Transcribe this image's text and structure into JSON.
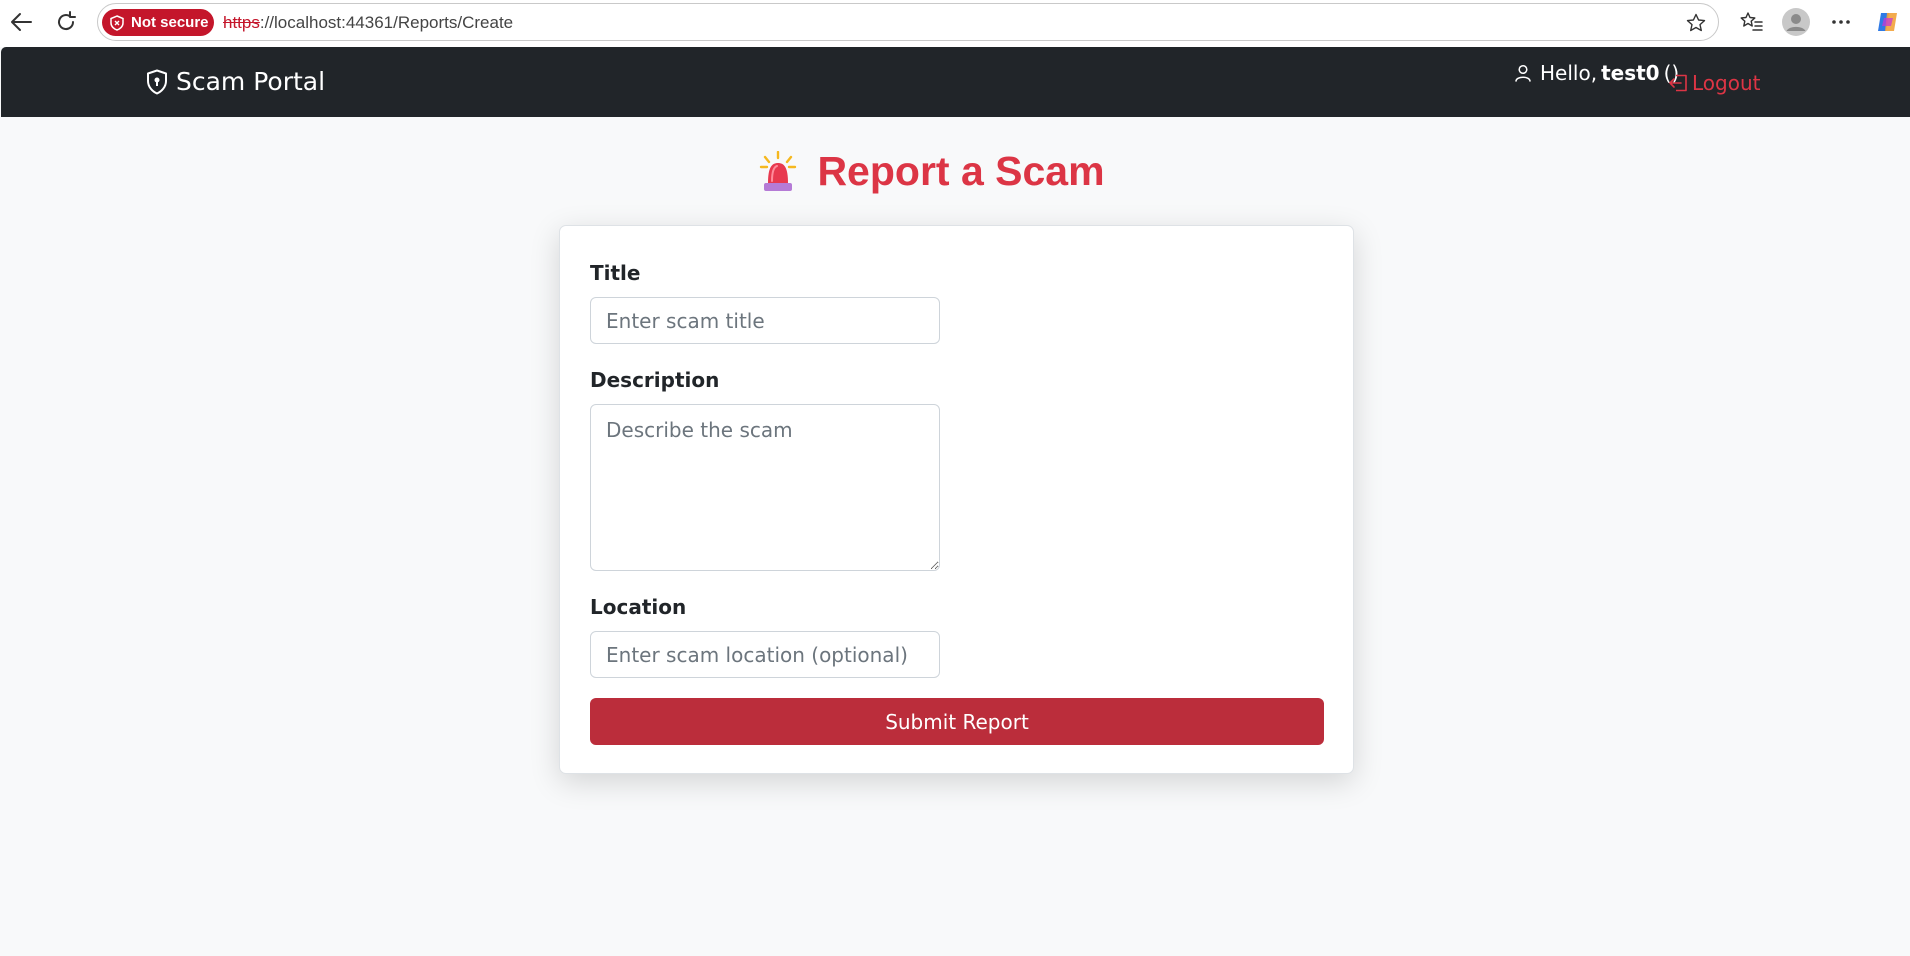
{
  "browser": {
    "security_label": "Not secure",
    "url_scheme": "https",
    "url_rest": "://localhost:44361/Reports/Create"
  },
  "navbar": {
    "brand": "Scam Portal",
    "greeting_prefix": "Hello,",
    "username": "test0",
    "greeting_suffix": "()",
    "logout_label": "Logout"
  },
  "page": {
    "title": "Report a Scam"
  },
  "form": {
    "title_label": "Title",
    "title_placeholder": "Enter scam title",
    "title_value": "",
    "description_label": "Description",
    "description_placeholder": "Describe the scam",
    "description_value": "",
    "location_label": "Location",
    "location_placeholder": "Enter scam location (optional)",
    "location_value": "",
    "submit_label": "Submit Report"
  },
  "colors": {
    "navbar_bg": "#212529",
    "accent_red": "#dc3545",
    "button_red": "#bb2d3b",
    "page_bg": "#f8f9fa"
  }
}
